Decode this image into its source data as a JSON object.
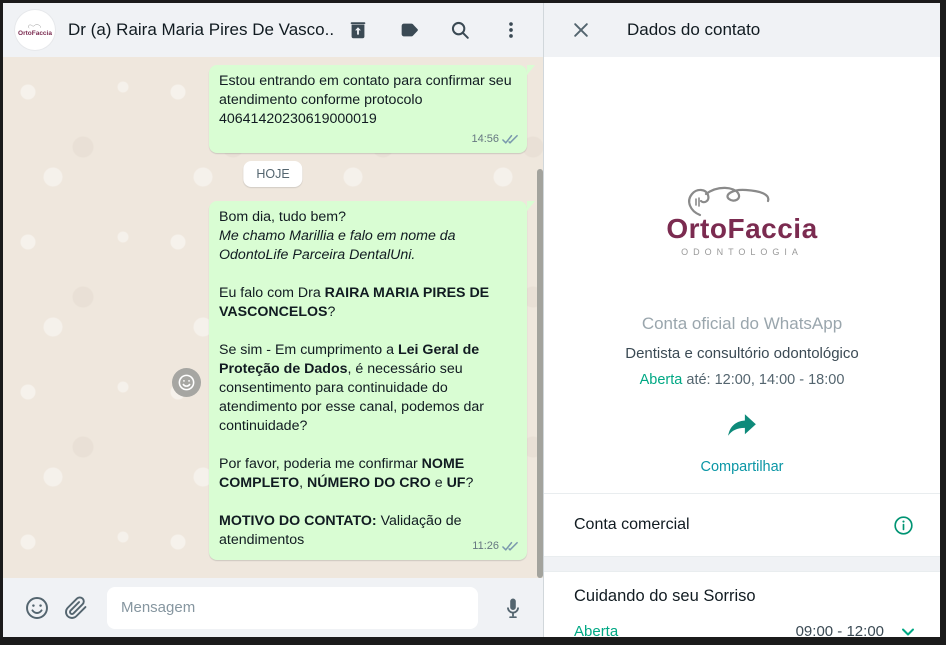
{
  "colors": {
    "header_bg": "#f0f2f5",
    "chat_bg": "#efe7dd",
    "bubble_green": "#d9fdd3",
    "accent_teal": "#0e8a7a",
    "share_label_teal": "#0a96a5",
    "open_green": "#00a884",
    "logo_plum": "#7b2b50",
    "icon_slate": "#3b4a54"
  },
  "chat": {
    "header": {
      "title": "Dr (a) Raira Maria Pires De Vasco...",
      "avatar_label": "OrtoFaccia",
      "icons": [
        "trash",
        "label",
        "search",
        "menu"
      ]
    },
    "date_divider": "HOJE",
    "messages": [
      {
        "time": "14:56",
        "status": "delivered-double-check",
        "paragraphs": [
          {
            "segments": [
              {
                "text": "Estou entrando em contato para confirmar seu atendimento conforme protocolo 40641420230619000019",
                "style": "normal"
              }
            ]
          }
        ]
      },
      {
        "time": "11:26",
        "status": "delivered-double-check",
        "paragraphs": [
          {
            "segments": [
              {
                "text": "Bom dia, tudo bem?",
                "style": "normal"
              }
            ]
          },
          {
            "segments": [
              {
                "text": "Me chamo Marillia e falo em nome da OdontoLife Parceira DentalUni.",
                "style": "italic"
              }
            ]
          },
          {
            "segments": [
              {
                "text": "Eu falo com Dra ",
                "style": "normal"
              },
              {
                "text": "RAIRA MARIA PIRES DE VASCONCELOS",
                "style": "bold"
              },
              {
                "text": "?",
                "style": "normal"
              }
            ]
          },
          {
            "segments": [
              {
                "text": "Se sim - Em cumprimento a ",
                "style": "normal"
              },
              {
                "text": "Lei Geral de Proteção de Dados",
                "style": "bold"
              },
              {
                "text": ", é necessário seu consentimento para continuidade do atendimento por esse canal, podemos dar continuidade?",
                "style": "normal"
              }
            ]
          },
          {
            "segments": [
              {
                "text": "Por favor, poderia me confirmar ",
                "style": "normal"
              },
              {
                "text": "NOME COMPLETO",
                "style": "bold"
              },
              {
                "text": ", ",
                "style": "normal"
              },
              {
                "text": "NÚMERO DO CRO",
                "style": "bold"
              },
              {
                "text": " e ",
                "style": "normal"
              },
              {
                "text": "UF",
                "style": "bold"
              },
              {
                "text": "?",
                "style": "normal"
              }
            ]
          },
          {
            "segments": [
              {
                "text": "MOTIVO DO CONTATO:",
                "style": "bold"
              },
              {
                "text": " Validação de atendimentos",
                "style": "normal"
              }
            ]
          }
        ]
      }
    ],
    "composer": {
      "placeholder": "Mensagem"
    }
  },
  "panel": {
    "header_title": "Dados do contato",
    "logo": {
      "name": "OrtoFaccia",
      "tagline": "ODONTOLOGIA"
    },
    "official_label": "Conta oficial do WhatsApp",
    "category": "Dentista e consultório odontológico",
    "hours": {
      "status": "Aberta",
      "rest": "até: 12:00, 14:00 - 18:00"
    },
    "share_label": "Compartilhar",
    "business_account_label": "Conta comercial",
    "bio": "Cuidando do seu Sorriso",
    "bottom": {
      "status": "Aberta",
      "hours": "09:00 - 12:00"
    }
  }
}
